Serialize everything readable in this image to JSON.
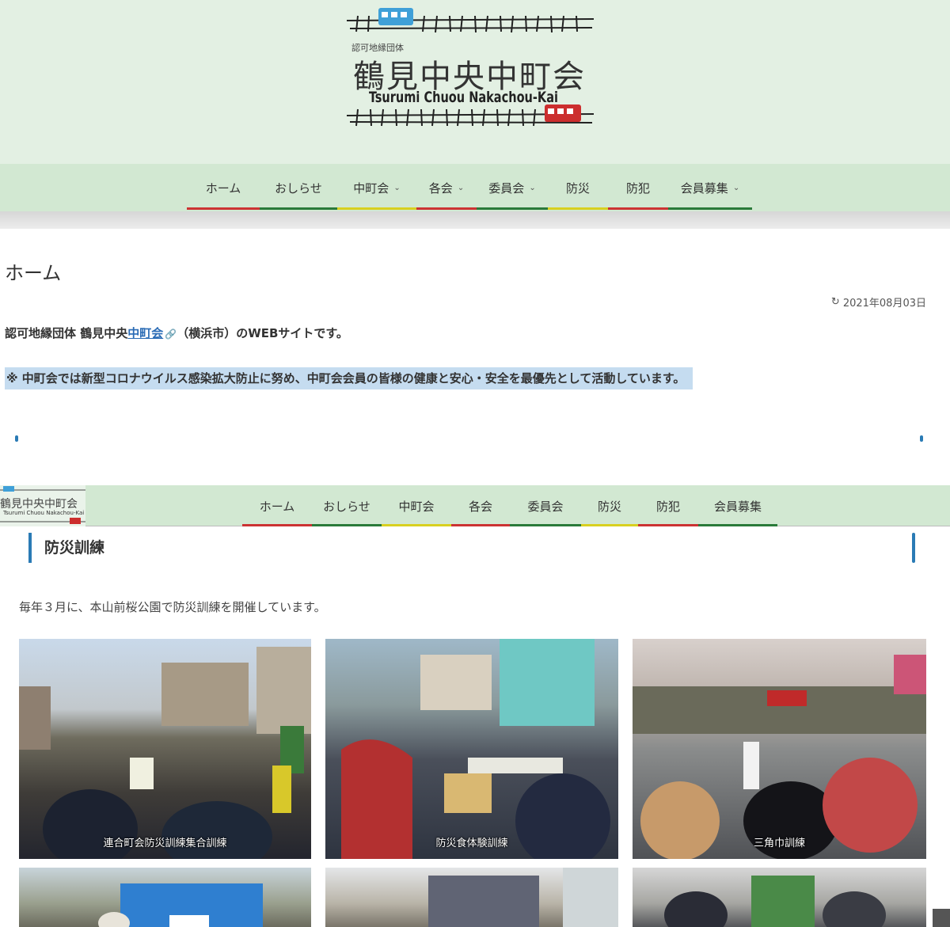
{
  "header": {
    "logo_sub": "認可地縁団体",
    "logo_title": "鶴見中央中町会",
    "logo_roman": "Tsurumi Chuou Nakachou-Kai"
  },
  "main_nav": [
    {
      "label": "ホーム",
      "chevron": false,
      "color": "#cc3333"
    },
    {
      "label": "おしらせ",
      "chevron": false,
      "color": "#2a7a3a"
    },
    {
      "label": "中町会",
      "chevron": true,
      "color": "#d8d020"
    },
    {
      "label": "各会",
      "chevron": true,
      "color": "#cc3333"
    },
    {
      "label": "委員会",
      "chevron": true,
      "color": "#2a7a3a"
    },
    {
      "label": "防災",
      "chevron": false,
      "color": "#d8d020"
    },
    {
      "label": "防犯",
      "chevron": false,
      "color": "#cc3333"
    },
    {
      "label": "会員募集",
      "chevron": true,
      "color": "#2a7a3a"
    }
  ],
  "content": {
    "page_title": "ホーム",
    "date": "2021年08月03日",
    "date_icon": "history-icon",
    "intro_prefix": "認可地縁団体 鶴見中央",
    "intro_link": "中町会",
    "intro_suffix": "（横浜市）のWEBサイトです。",
    "notice": "※ 中町会では新型コロナウイルス感染拡大防止に努め、中町会会員の皆様の健康と安心・安全を最優先として活動しています。"
  },
  "sticky_nav": {
    "mini_logo_title": "鶴見中央中町会",
    "mini_logo_roman": "Tsurumi Chuou Nakachou-Kai",
    "items": [
      "ホーム",
      "おしらせ",
      "中町会",
      "各会",
      "委員会",
      "防災",
      "防犯",
      "会員募集"
    ]
  },
  "section": {
    "title": "防災訓練",
    "description": "毎年３月に、本山前桜公園で防災訓練を開催しています。"
  },
  "photos": [
    {
      "caption": "連合町会防災訓練集合訓練"
    },
    {
      "caption": "防災食体験訓練"
    },
    {
      "caption": "三角巾訓練"
    },
    {
      "caption": ""
    },
    {
      "caption": ""
    },
    {
      "caption": ""
    }
  ],
  "colors": {
    "header_bg": "#e3f0e3",
    "nav_bg": "#d2e8d2",
    "accent_blue": "#2a7bb5",
    "link": "#2a6bb5",
    "highlight": "#c5dcf0"
  }
}
